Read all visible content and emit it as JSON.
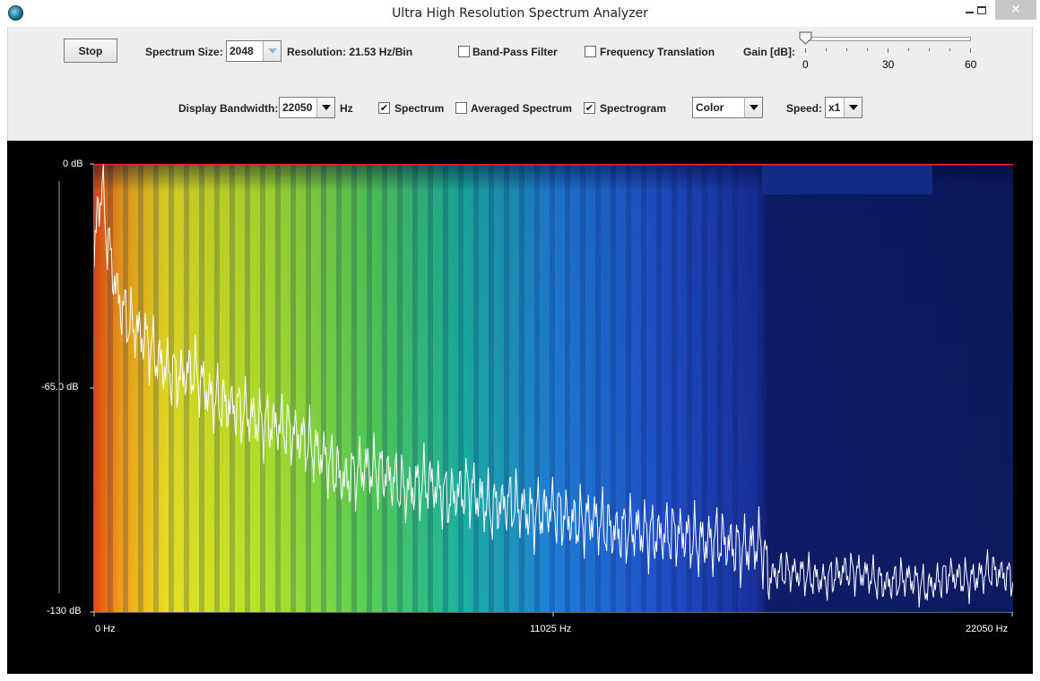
{
  "window": {
    "title": "Ultra High Resolution Spectrum Analyzer"
  },
  "controls": {
    "stop_label": "Stop",
    "spectrum_size_label": "Spectrum Size:",
    "spectrum_size_value": "2048",
    "resolution_text": "Resolution: 21.53 Hz/Bin",
    "band_pass_label": "Band-Pass Filter",
    "band_pass_checked": false,
    "freq_translation_label": "Frequency Translation",
    "freq_translation_checked": false,
    "gain_label": "Gain [dB]:",
    "gain_value": 0,
    "gain_ticks": [
      "0",
      "30",
      "60"
    ],
    "display_bandwidth_label": "Display Bandwidth:",
    "display_bandwidth_value": "22050",
    "hz_unit": "Hz",
    "spectrum_label": "Spectrum",
    "spectrum_checked": true,
    "averaged_label": "Averaged Spectrum",
    "averaged_checked": false,
    "spectrogram_label": "Spectrogram",
    "spectrogram_checked": true,
    "color_mode_value": "Color",
    "speed_label": "Speed:",
    "speed_value": "x1"
  },
  "display": {
    "y_labels": {
      "top": "0 dB",
      "mid": "-65.0 dB",
      "bottom": "-130 dB"
    },
    "x_labels": {
      "left": "0 Hz",
      "mid": "11025 Hz",
      "right": "22050 Hz"
    },
    "colors": {
      "trace": "#ffffff",
      "reference_line": "#ff2020",
      "background": "#000000"
    }
  },
  "chart_data": {
    "type": "line",
    "title": "",
    "xlabel": "",
    "ylabel": "",
    "xlim": [
      0,
      22050
    ],
    "ylim": [
      -130,
      0
    ],
    "x_ticks": [
      "0 Hz",
      "11025 Hz",
      "22050 Hz"
    ],
    "y_ticks": [
      "0 dB",
      "-65.0 dB",
      "-130 dB"
    ],
    "series": [
      {
        "x": [
          0,
          100,
          200,
          300,
          400,
          600,
          800,
          1000,
          1300,
          1600,
          2000,
          2400,
          2800,
          3200,
          3600,
          4000,
          4500,
          5000,
          5500,
          6000,
          6500,
          7000,
          7500,
          8000,
          8500,
          9000,
          9500,
          10000,
          10500,
          11000,
          11500,
          12000,
          12500,
          13000,
          13500,
          14000,
          14500,
          15000,
          15500,
          16000,
          16200,
          16500,
          17000,
          17500,
          18000,
          18500,
          19000,
          19500,
          20000,
          20500,
          21000,
          21500,
          22050
        ],
        "values": [
          -30,
          -10,
          -8,
          -20,
          -28,
          -40,
          -45,
          -48,
          -52,
          -58,
          -62,
          -60,
          -68,
          -70,
          -72,
          -75,
          -76,
          -80,
          -85,
          -92,
          -88,
          -90,
          -95,
          -92,
          -97,
          -94,
          -100,
          -98,
          -102,
          -100,
          -104,
          -103,
          -107,
          -106,
          -108,
          -107,
          -110,
          -109,
          -112,
          -110,
          -120,
          -118,
          -119,
          -121,
          -118,
          -119,
          -122,
          -120,
          -123,
          -119,
          -121,
          -118,
          -120
        ]
      }
    ],
    "reference_line_db": 0
  }
}
